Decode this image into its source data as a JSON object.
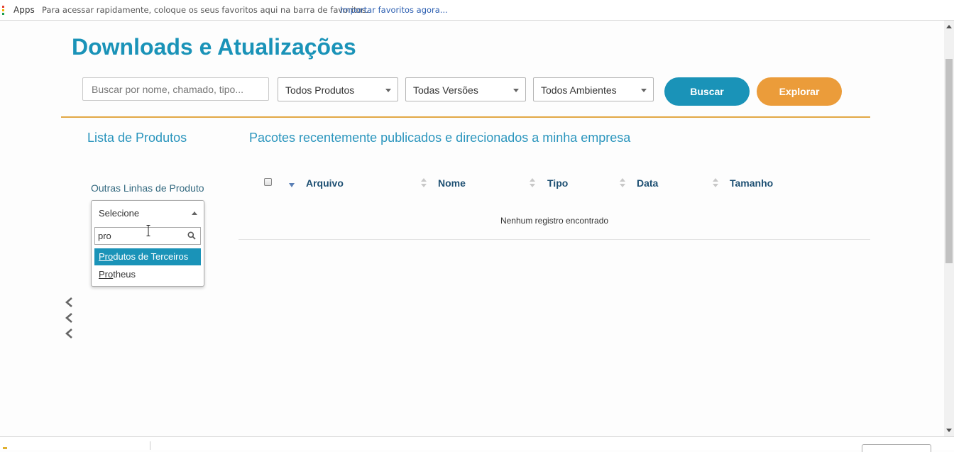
{
  "bookmarks_bar": {
    "apps_label": "Apps",
    "hint": "Para acessar rapidamente, coloque os seus favoritos aqui na barra de favoritos.",
    "import_link": "Importar favoritos agora..."
  },
  "page": {
    "title": "Downloads e Atualizações"
  },
  "filters": {
    "search_placeholder": "Buscar por nome, chamado, tipo...",
    "products_select": "Todos Produtos",
    "versions_select": "Todas Versões",
    "environments_select": "Todos Ambientes",
    "search_button": "Buscar",
    "explore_button": "Explorar"
  },
  "sidebar": {
    "title": "Lista de Produtos",
    "other_lines_label": "Outras Linhas de Produto",
    "combo": {
      "selected": "Selecione",
      "search_value": "pro",
      "options": [
        {
          "match": "Pro",
          "rest": "dutos de Terceiros",
          "highlighted": true
        },
        {
          "match": "Pro",
          "rest": "theus",
          "highlighted": false
        }
      ]
    }
  },
  "main": {
    "title": "Pacotes recentemente publicados e direcionados a minha empresa",
    "table": {
      "columns": [
        "Arquivo",
        "Nome",
        "Tipo",
        "Data",
        "Tamanho"
      ],
      "empty_message": "Nenhum registro encontrado"
    }
  },
  "colors": {
    "brand_blue": "#1a93b8",
    "explore_orange": "#eb9c3a",
    "divider_gold": "#e2a845",
    "header_text": "#1d4f72"
  },
  "icons": [
    "apps-icon",
    "caret-down-icon",
    "caret-up-icon",
    "search-icon",
    "text-cursor-icon",
    "chevron-left-icon",
    "sort-icon",
    "checkbox"
  ]
}
